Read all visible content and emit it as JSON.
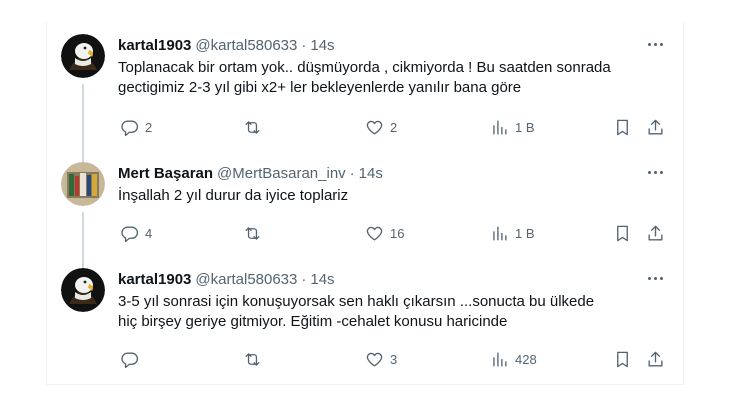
{
  "tweets": [
    {
      "name": "kartal1903",
      "handle": "@kartal580633",
      "time": "14s",
      "avatar": "eagle",
      "lines": [
        "Toplanacak bir ortam yok.. düşmüyorda , cikmiyorda ! Bu saatden sonrada",
        "gectigimiz 2-3 yıl gibi x2+ ler bekleyenlerde yanılır bana göre"
      ],
      "replies": "2",
      "retweets": "",
      "likes": "2",
      "views": "1 B"
    },
    {
      "name": "Mert Başaran",
      "handle": "@MertBasaran_inv",
      "time": "14s",
      "avatar": "books",
      "lines": [
        "İnşallah 2 yıl durur da iyice toplariz"
      ],
      "replies": "4",
      "retweets": "",
      "likes": "16",
      "views": "1 B"
    },
    {
      "name": "kartal1903",
      "handle": "@kartal580633",
      "time": "14s",
      "avatar": "eagle",
      "lines": [
        "3-5 yıl sonrasi için konuşuyorsak sen haklı çıkarsın ...sonucta bu ülkede",
        "hiç birşey geriye gitmiyor. Eğitim -cehalet konusu haricinde"
      ],
      "replies": "",
      "retweets": "",
      "likes": "3",
      "views": "428"
    }
  ],
  "separator": "·",
  "icons": {
    "reply": "reply-icon",
    "retweet": "retweet-icon",
    "like": "heart-icon",
    "views": "views-icon",
    "bookmark": "bookmark-icon",
    "share": "share-icon",
    "more": "more-icon"
  },
  "colors": {
    "text": "#0f1419",
    "secondary": "#536471",
    "thread_line": "#cfd9de"
  }
}
